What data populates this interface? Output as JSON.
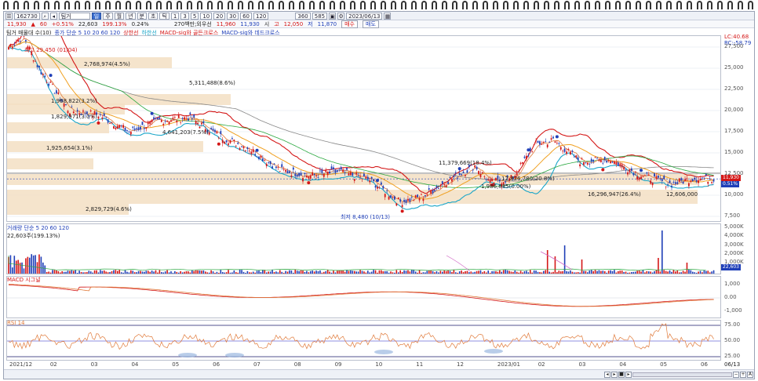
{
  "toolbar": {
    "code": "162730",
    "name": "팀거",
    "period_buttons": [
      "주",
      "월",
      "년",
      "분",
      "초",
      "틱"
    ],
    "minute_buttons": [
      "1",
      "3",
      "5",
      "10",
      "20",
      "30",
      "60",
      "120"
    ],
    "count": "360",
    "count2": "585",
    "date": "2023/06/13"
  },
  "pricebar": {
    "price": "11,930",
    "change": "60",
    "change_pct": "+0.51%",
    "volume": "22,603",
    "vol_pct": "199.13%",
    "turnover": "0.24%",
    "amount": "270백만;외우선",
    "open_label": "시",
    "open": "11,960",
    "high_label": "고",
    "high": "12,050",
    "low_label": "저",
    "low": "11,870",
    "prev": "11,930",
    "buy_label": "매수",
    "sell_label": "매도"
  },
  "legend": {
    "title": "팀거 매물대 수(10)",
    "ma": "종가 단순 5 10 20 60 120",
    "upper": "상한선",
    "lower": "하한선",
    "macd_gc": "MACD-sig와 골든크로스",
    "macd_dc": "MACD-sig와 데드크로스",
    "lc": "LC:40.68",
    "rc": "RC:-58.79"
  },
  "price_axis": [
    "27,500",
    "25,000",
    "22,500",
    "20,000",
    "17,500",
    "15,000",
    "12,500",
    "10,000",
    "7,500"
  ],
  "price_tags": {
    "last": "11,930",
    "pct": "0.51%"
  },
  "annotations": {
    "high": "최고 29,450 (01/04)",
    "low": "최저 8,480 (10/13)",
    "boxes": [
      "2,768,974(4.5%)",
      "5,311,488(8.6%)",
      "1,968,822(3.2%)",
      "1,829,971(3.0%)",
      "4,641,203(7.5%)",
      "1,925,654(3.1%)",
      "11,379,669(18.4%)",
      "12,826,780(20.8%)",
      "16,296,947(26.4%)",
      "2,829,729(4.6%)"
    ],
    "mid1": "1,986,835(0.00%)",
    "mid2": "12,606,000"
  },
  "volume_panel": {
    "legend": "거래량 단순 5 20 60 120",
    "value": "22,603주(199.13%)",
    "axis": [
      "5,000K",
      "4,000K",
      "3,000K",
      "2,000K",
      "1,000K"
    ],
    "tag": "22,603"
  },
  "macd_panel": {
    "legend": "MACD 시그널",
    "axis": [
      "1,000",
      "0.00",
      "-1,000"
    ]
  },
  "rsi_panel": {
    "legend": "RSI 14",
    "axis": [
      "75.00",
      "50.00",
      "25.00"
    ]
  },
  "x_axis": [
    "2021/12",
    "02",
    "03",
    "04",
    "05",
    "06",
    "07",
    "08",
    "09",
    "10",
    "11",
    "12",
    "2023/01",
    "02",
    "03",
    "04",
    "05",
    "06"
  ],
  "x_axis_end": "06/13",
  "colors": {
    "up": "#d41717",
    "down": "#1f3fb8",
    "ma5": "#e07a3a",
    "ma20": "#f0a020",
    "ma60": "#2aa840",
    "ma120": "#888888",
    "upper": "#d41717",
    "lower": "#1aa6c9",
    "box": "#f3dfc3"
  }
}
